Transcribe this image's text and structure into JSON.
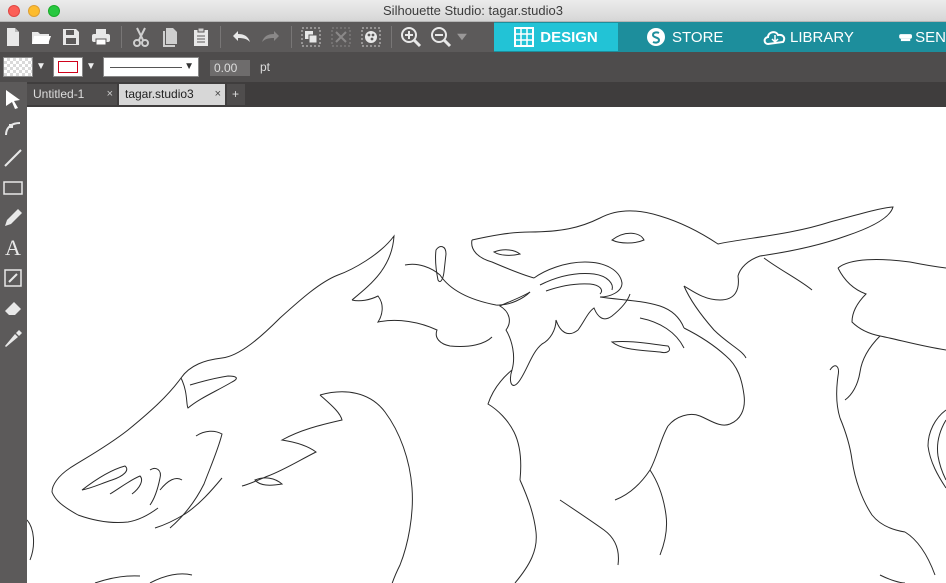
{
  "window": {
    "title": "Silhouette Studio: tagar.studio3"
  },
  "toolbar": {
    "icons": [
      "new-document-icon",
      "open-folder-icon",
      "save-icon",
      "print-icon",
      "cut-icon",
      "copy-icon",
      "paste-icon",
      "undo-icon",
      "redo-icon",
      "group-icon",
      "ungroup-icon",
      "fill-palette-icon",
      "zoom-in-icon",
      "zoom-out-icon",
      "zoom-dropdown-icon"
    ],
    "nav_tabs": [
      {
        "label": "DESIGN",
        "active": true
      },
      {
        "label": "STORE",
        "active": false
      },
      {
        "label": "LIBRARY",
        "active": false
      },
      {
        "label": "SEN",
        "active": false
      }
    ],
    "accent_active": "#22c3d6",
    "accent_nav": "#1d8e9c"
  },
  "options": {
    "fill_color": "transparent",
    "line_color": "#d0021b",
    "line_width_value": "0.00",
    "line_width_unit": "pt"
  },
  "tabs": [
    {
      "label": "Untitled-1",
      "close": "×",
      "active": false
    },
    {
      "label": "tagar.studio3",
      "close": "×",
      "active": true
    },
    {
      "label": "+"
    }
  ],
  "tools": [
    "select-icon",
    "edit-points-icon",
    "line-icon",
    "rectangle-icon",
    "draw-pencil-icon",
    "text-icon",
    "cut-panel-icon",
    "eraser-icon",
    "knife-icon"
  ]
}
